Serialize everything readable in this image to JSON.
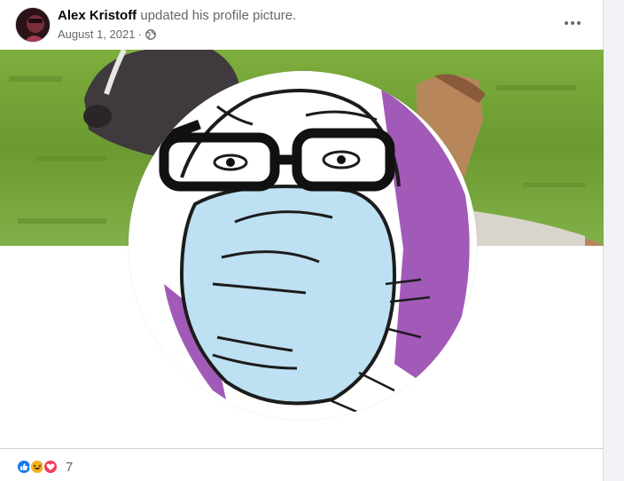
{
  "post": {
    "author": "Alex Kristoff",
    "action": "updated his profile picture.",
    "date": "August 1, 2021",
    "separator": "·",
    "privacy_icon": "globe-icon",
    "more_icon": "more-options-icon"
  },
  "images": {
    "cover_description_icon": "cover-photo",
    "profile_picture_icon": "profile-picture"
  },
  "reactions": {
    "icons": [
      "like-icon",
      "haha-icon",
      "love-icon"
    ],
    "count": "7"
  },
  "colors": {
    "like": "#1877f2",
    "haha": "#f7b125",
    "love": "#f33e58",
    "text_primary": "#050505",
    "text_secondary": "#65676b"
  }
}
